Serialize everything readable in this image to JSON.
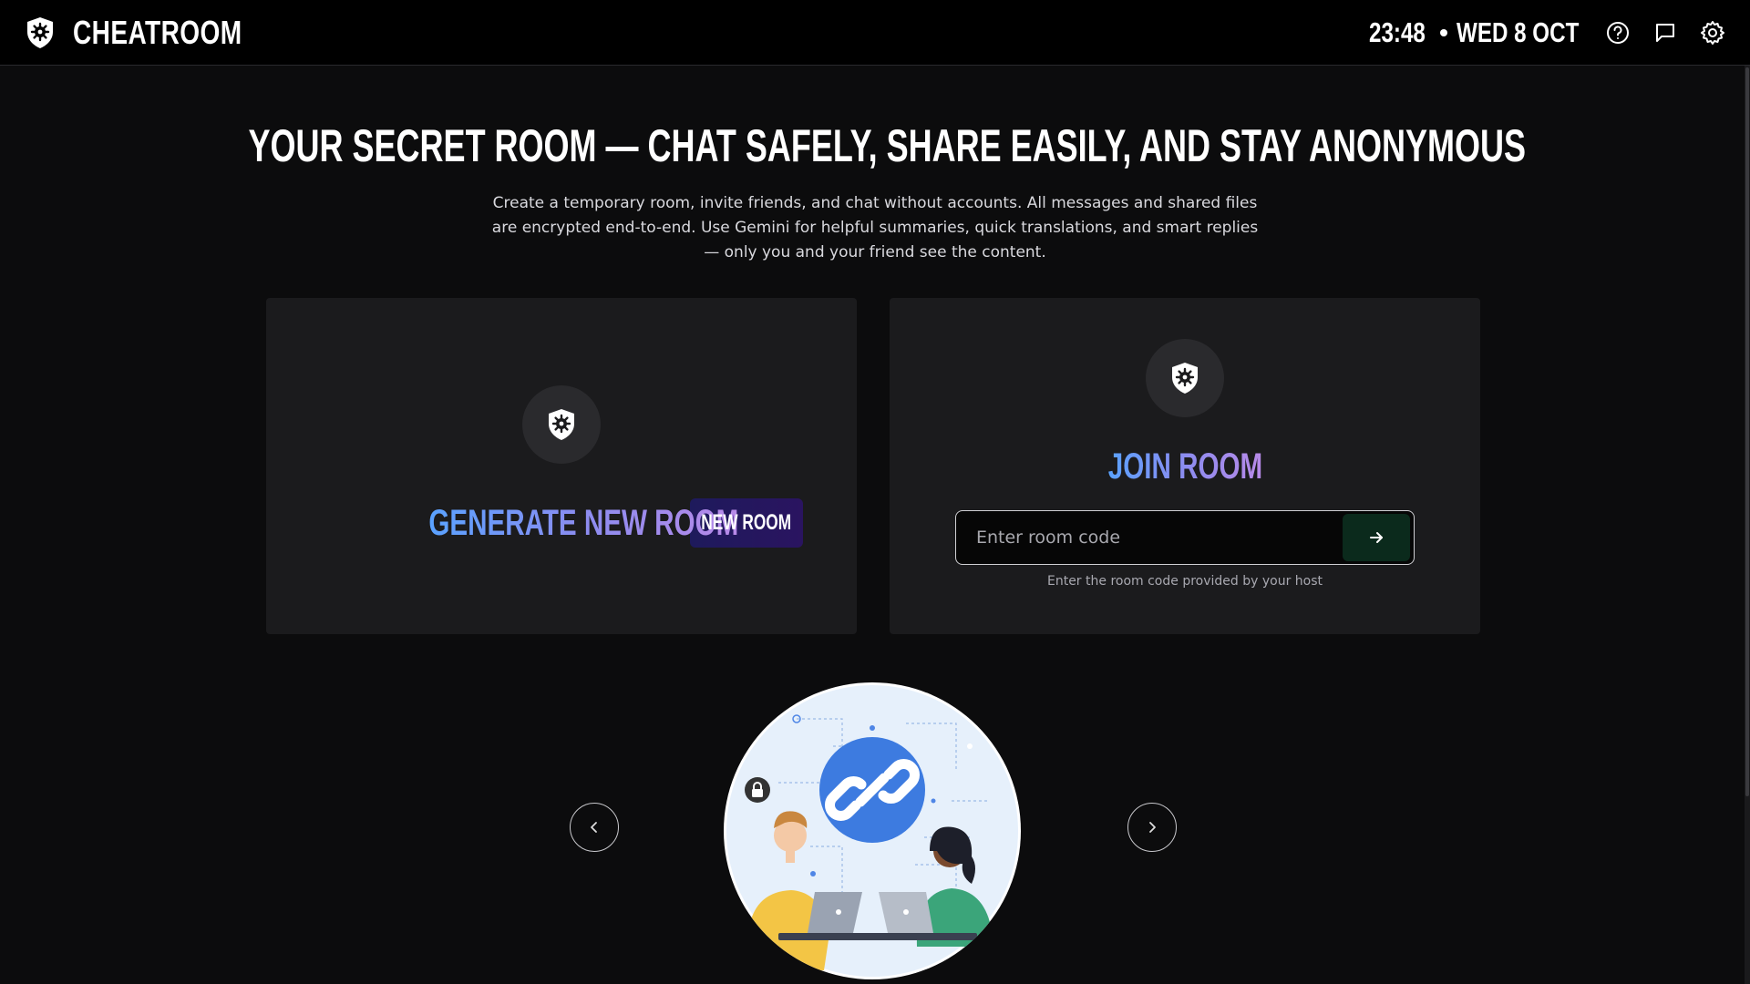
{
  "app": {
    "name": "CHEATROOM"
  },
  "header": {
    "time": "23:48",
    "date": "WED 8 OCT",
    "icons": [
      "help-circle-icon",
      "chat-bubble-icon",
      "gear-icon"
    ]
  },
  "hero": {
    "title": "YOUR SECRET ROOM — CHAT SAFELY, SHARE EASILY, AND STAY ANONYMOUS",
    "subtitle": "Create a temporary room, invite friends, and chat without accounts. All messages and shared files are encrypted end-to-end. Use Gemini for helpful summaries, quick translations, and smart replies — only you and your friend see the content."
  },
  "generate": {
    "title": "GENERATE NEW ROOM",
    "button_label": "NEW ROOM",
    "icon": "shield-icon"
  },
  "join": {
    "title": "JOIN ROOM",
    "placeholder": "Enter room code",
    "value": "",
    "hint": "Enter the room code provided by your host",
    "submit_icon": "arrow-right-icon",
    "icon": "shield-icon"
  },
  "carousel": {
    "prev_icon": "chevron-left-icon",
    "next_icon": "chevron-right-icon",
    "illustration": "two-people-shared-link-illustration"
  },
  "colors": {
    "background": "#0c0c0d",
    "card": "#1b1b1d",
    "gradient_start": "#5aa2ff",
    "gradient_end": "#b88ae8",
    "new_room_button": "#1e1a5c",
    "join_button": "#0b2a1c"
  }
}
